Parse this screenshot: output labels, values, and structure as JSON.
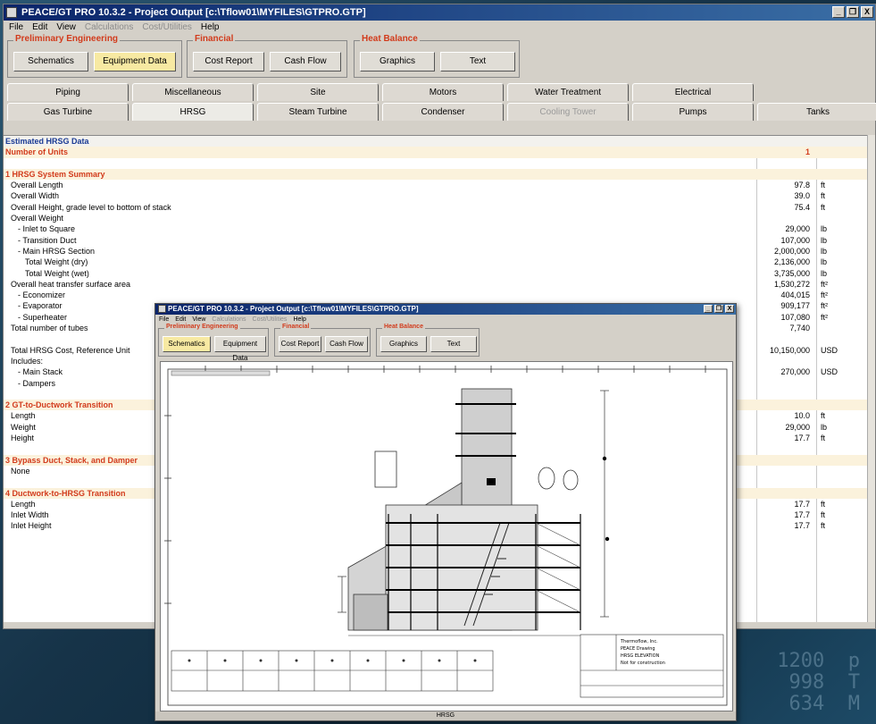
{
  "window": {
    "title": "PEACE/GT PRO 10.3.2 - Project Output [c:\\Tflow01\\MYFILES\\GTPRO.GTP]",
    "controls": [
      "_",
      "❐",
      "X"
    ]
  },
  "menu": [
    {
      "label": "File",
      "disabled": false
    },
    {
      "label": "Edit",
      "disabled": false
    },
    {
      "label": "View",
      "disabled": false
    },
    {
      "label": "Calculations",
      "disabled": true
    },
    {
      "label": "Cost/Utilities",
      "disabled": true
    },
    {
      "label": "Help",
      "disabled": false
    }
  ],
  "groups": {
    "prelim": {
      "label": "Preliminary Engineering",
      "buttons": [
        "Schematics",
        "Equipment Data"
      ]
    },
    "financial": {
      "label": "Financial",
      "buttons": [
        "Cost Report",
        "Cash Flow"
      ]
    },
    "heat": {
      "label": "Heat Balance",
      "buttons": [
        "Graphics",
        "Text"
      ]
    }
  },
  "tabs_row1": [
    "Piping",
    "Miscellaneous",
    "Site",
    "Motors",
    "Water Treatment",
    "Electrical"
  ],
  "tabs_row2": [
    "Gas Turbine",
    "HRSG",
    "Steam Turbine",
    "Condenser",
    "Cooling Tower",
    "Pumps",
    "Tanks"
  ],
  "sheet_rows": [
    {
      "label": "Estimated HRSG Data",
      "value": "",
      "unit": "",
      "style": "hdr"
    },
    {
      "label": "Number of Units",
      "value": "1",
      "unit": "",
      "style": "sec"
    },
    {
      "label": "",
      "value": "",
      "unit": "",
      "style": "blank"
    },
    {
      "label": "1  HRSG System Summary",
      "value": "",
      "unit": "",
      "style": "sec"
    },
    {
      "label": "Overall Length",
      "value": "97.8",
      "unit": "ft",
      "indent": 1
    },
    {
      "label": "Overall Width",
      "value": "39.0",
      "unit": "ft",
      "indent": 1
    },
    {
      "label": "Overall Height, grade level to bottom of stack",
      "value": "75.4",
      "unit": "ft",
      "indent": 1
    },
    {
      "label": "Overall Weight",
      "value": "",
      "unit": "",
      "indent": 1
    },
    {
      "label": "- Inlet to Square",
      "value": "29,000",
      "unit": "lb",
      "indent": 2
    },
    {
      "label": "- Transition Duct",
      "value": "107,000",
      "unit": "lb",
      "indent": 2
    },
    {
      "label": "- Main HRSG Section",
      "value": "2,000,000",
      "unit": "lb",
      "indent": 2
    },
    {
      "label": "Total Weight (dry)",
      "value": "2,136,000",
      "unit": "lb",
      "indent": 3
    },
    {
      "label": "Total Weight (wet)",
      "value": "3,735,000",
      "unit": "lb",
      "indent": 3
    },
    {
      "label": "Overall heat transfer surface area",
      "value": "1,530,272",
      "unit": "ft²",
      "indent": 1
    },
    {
      "label": "- Economizer",
      "value": "404,015",
      "unit": "ft²",
      "indent": 2
    },
    {
      "label": "- Evaporator",
      "value": "909,177",
      "unit": "ft²",
      "indent": 2
    },
    {
      "label": "- Superheater",
      "value": "107,080",
      "unit": "ft²",
      "indent": 2
    },
    {
      "label": "Total number of tubes",
      "value": "7,740",
      "unit": "",
      "indent": 1
    },
    {
      "label": "",
      "value": "",
      "unit": "",
      "style": "blank"
    },
    {
      "label": "Total HRSG Cost, Reference Unit",
      "value": "10,150,000",
      "unit": "USD",
      "indent": 1
    },
    {
      "label": "Includes:",
      "value": "",
      "unit": "",
      "indent": 1
    },
    {
      "label": "- Main Stack",
      "value": "270,000",
      "unit": "USD",
      "indent": 2
    },
    {
      "label": "- Dampers",
      "value": "",
      "unit": "",
      "indent": 2
    },
    {
      "label": "",
      "value": "",
      "unit": "",
      "style": "blank"
    },
    {
      "label": "2  GT-to-Ductwork Transition",
      "value": "",
      "unit": "",
      "style": "sec"
    },
    {
      "label": "Length",
      "value": "10.0",
      "unit": "ft",
      "indent": 1
    },
    {
      "label": "Weight",
      "value": "29,000",
      "unit": "lb",
      "indent": 1
    },
    {
      "label": "Height",
      "value": "17.7",
      "unit": "ft",
      "indent": 1
    },
    {
      "label": "",
      "value": "",
      "unit": "",
      "style": "blank"
    },
    {
      "label": "3  Bypass Duct, Stack, and Damper",
      "value": "",
      "unit": "",
      "style": "sec"
    },
    {
      "label": "None",
      "value": "",
      "unit": "",
      "indent": 1
    },
    {
      "label": "",
      "value": "",
      "unit": "",
      "style": "blank"
    },
    {
      "label": "4  Ductwork-to-HRSG Transition",
      "value": "",
      "unit": "",
      "style": "sec"
    },
    {
      "label": "Length",
      "value": "17.7",
      "unit": "ft",
      "indent": 1
    },
    {
      "label": "Inlet Width",
      "value": "17.7",
      "unit": "ft",
      "indent": 1
    },
    {
      "label": "Inlet Height",
      "value": "17.7",
      "unit": "ft",
      "indent": 1
    }
  ],
  "popup": {
    "title": "PEACE/GT PRO 10.3.2 - Project Output [c:\\Tflow01\\MYFILES\\GTPRO.GTP]",
    "menu": [
      "File",
      "Edit",
      "View",
      "Calculations",
      "Cost/Utilities",
      "Help"
    ],
    "groups": {
      "prelim": {
        "label": "Preliminary Engineering",
        "buttons": [
          "Schematics",
          "Equipment Data"
        ]
      },
      "financial": {
        "label": "Financial",
        "buttons": [
          "Cost Report",
          "Cash Flow"
        ]
      },
      "heat": {
        "label": "Heat Balance",
        "buttons": [
          "Graphics",
          "Text"
        ]
      }
    },
    "status": "HRSG",
    "drawing_title_lines": [
      "Thermoflow, Inc.",
      "PEACE Drawing",
      "HRSG ELEVATION",
      "Not for construction"
    ]
  },
  "background_text": "1200  p\n998  T\n634  M",
  "colors": {
    "section": "#d23b1c",
    "header": "#1a3a94",
    "active_button": "#f7e9a2",
    "title_bar": "#0a246a"
  }
}
